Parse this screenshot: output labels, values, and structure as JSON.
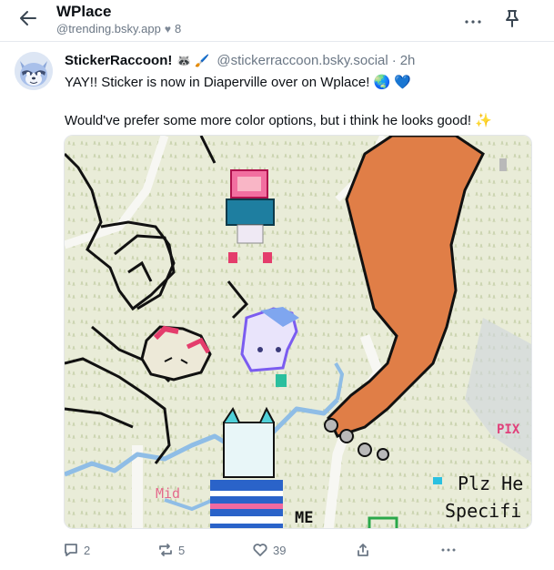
{
  "header": {
    "title": "WPlace",
    "handle": "@trending.bsky.app",
    "likes": "8"
  },
  "post": {
    "author": {
      "display_name": "StickerRaccoon!",
      "emojis": "🦝 🖌️",
      "handle": "@stickerraccoon.bsky.social",
      "separator": "·",
      "time": "2h"
    },
    "text_line1": "YAY!! Sticker is now in Diaperville over on Wplace! 🌏 💙",
    "text_line2": "Would've prefer some more color options, but i think he looks good! ✨",
    "image_texts": {
      "pixel_right": "PIX",
      "plz": "Plz He",
      "specific": "Specifi",
      "mid": "Mid",
      "me": "ME"
    },
    "actions": {
      "reply_count": "2",
      "repost_count": "5",
      "like_count": "39"
    }
  },
  "colors": {
    "accent": "#1083fe",
    "map_bg": "#e9ecd9",
    "road": "#f7f7f4",
    "river": "#8fbde6",
    "leg": "#e07e47",
    "muted": "#6b7785"
  }
}
